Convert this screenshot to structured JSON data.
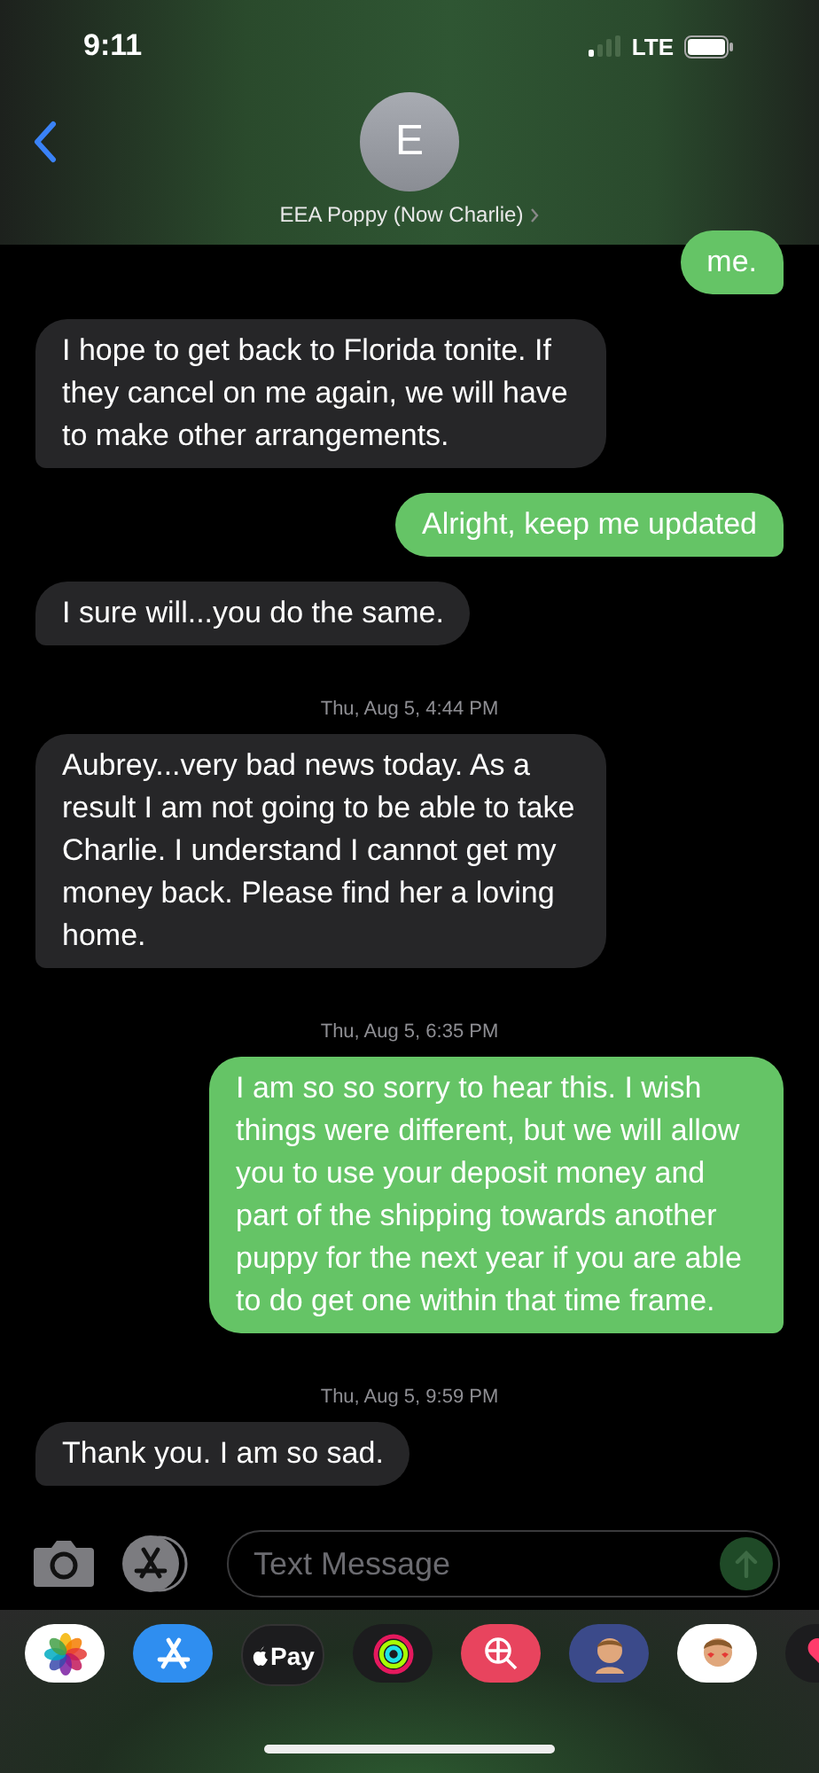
{
  "status_bar": {
    "time": "9:11",
    "network": "LTE"
  },
  "header": {
    "avatar_initial": "E",
    "contact_name": "EEA Poppy (Now Charlie)"
  },
  "messages": [
    {
      "kind": "sent",
      "text": "me."
    },
    {
      "kind": "received",
      "text": "I hope to get back to Florida tonite.  If they cancel on me again, we will have to make other arrangements."
    },
    {
      "kind": "sent",
      "text": "Alright, keep me updated"
    },
    {
      "kind": "received",
      "text": "I sure will...you do the same."
    },
    {
      "kind": "timestamp",
      "text": "Thu, Aug 5, 4:44 PM"
    },
    {
      "kind": "received",
      "text": "Aubrey...very bad news today.  As a result I am not going to be able to take Charlie.  I understand I cannot get my money back.  Please find her a loving home."
    },
    {
      "kind": "timestamp",
      "text": "Thu, Aug 5, 6:35 PM"
    },
    {
      "kind": "sent",
      "text": "I am so so sorry to hear this. I wish things were different, but we will allow you to use your deposit money and part of the shipping towards another puppy for the next year if you are able to do get one within that time frame."
    },
    {
      "kind": "timestamp",
      "text": "Thu, Aug 5, 9:59 PM"
    },
    {
      "kind": "received",
      "text": "Thank you.  I am so sad."
    }
  ],
  "composer": {
    "placeholder": "Text Message"
  },
  "app_drawer": [
    {
      "kind": "photos"
    },
    {
      "kind": "appstore"
    },
    {
      "kind": "applepay",
      "label": "Pay"
    },
    {
      "kind": "activity"
    },
    {
      "kind": "websearch"
    },
    {
      "kind": "memoji"
    },
    {
      "kind": "stickers"
    },
    {
      "kind": "hearts"
    }
  ]
}
